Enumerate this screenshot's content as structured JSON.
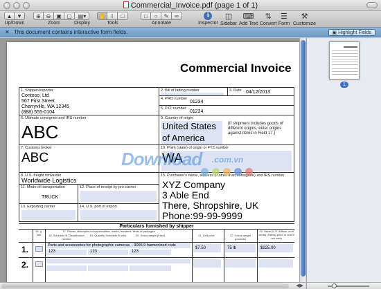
{
  "window": {
    "title": "Commercial_Invoice.pdf (page 1 of 1)"
  },
  "toolbar": {
    "updown_label": "Up/Down",
    "zoom_label": "Zoom",
    "display_label": "Display",
    "tools_label": "Tools",
    "annotate_label": "Annotate",
    "inspector_label": "Inspector",
    "sidebar_label": "Sidebar",
    "addtext_label": "Add Text",
    "convert_label": "Convert",
    "form_label": "Form",
    "customize_label": "Customize"
  },
  "notice": {
    "message": "This document contains interactive form fields.",
    "button": "Highlight Fields"
  },
  "sidebar": {
    "page_number": "1"
  },
  "invoice": {
    "title": "Commercial Invoice",
    "shipper_label": "1. Shipper/exporter",
    "shipper_lines": [
      "Contoso, Ltd",
      "567 First Street",
      "Cherryville, WA 12345",
      "(888) 555-0104"
    ],
    "bill_label": "2. Bill of lading number",
    "date_label": "3. Date",
    "date_value": "04/12/2013",
    "pro_label": "4. PRO number",
    "pro_value": "01234",
    "po_label": "5. P.O. number",
    "po_value": "01234",
    "consignee_label": "6. Ultimate consignee and IRS number",
    "consignee_value": "ABC",
    "origin_label": "9. Country of origin",
    "origin_value_1": "United States",
    "origin_value_2": "of America",
    "origin_note": "(If shipment includes goods of different origins, enter origins against items in Field 17.)",
    "broker_label": "7. Customs broker",
    "broker_value": "ABC",
    "state_label": "10. Point (state) of origin or FTZ number",
    "state_value": "WA",
    "forwarder_label": "8. U.S. freight forwarder",
    "forwarder_value": "Worldwide Logistics",
    "purchaser_label": "15. Purchaser's name, address (if other than consignee) and IRS number",
    "purchaser_lines": [
      "XYZ Company",
      "3 Able End",
      "There, Shropshire, UK",
      "Phone:99-99-9999"
    ],
    "transport_label": "11. Mode of transportation",
    "transport_value": "TRUCK",
    "receipt_label": "12. Place of receipt by pre-carrier",
    "exporting_label": "13. Exporting carrier",
    "export_port_label": "14. U.S. port of export",
    "particulars_title": "Particulars furnished by shipper",
    "columns": [
      "16. g. sub",
      "17. Pieces, description of commodities, marks, numbers, kinds of packages",
      "18. Schedule B Classification number",
      "19. Quantity Schedule B units",
      "20. Gross weight (Kilos)",
      "21. Unit price",
      "22. Gross weight (pounds)",
      "23. Value (U.S. dollars, omit cents) (Selling price or cost if not sold)"
    ],
    "rows": [
      {
        "number": "1.",
        "description": "Parts and accessories for photographic cameras. - 9006.9 harmonized code",
        "schedule_b": "123",
        "quantity": "123",
        "gross_kilos": "123",
        "unit_price": "$7.50",
        "gross_lb": "75 lb",
        "value": "$225.00"
      },
      {
        "number": "2.",
        "description": "",
        "schedule_b": "",
        "quantity": "",
        "gross_kilos": "",
        "unit_price": "",
        "gross_lb": "",
        "value": ""
      }
    ]
  },
  "watermark": {
    "brand": "Download",
    "domain": ".com.vn"
  }
}
